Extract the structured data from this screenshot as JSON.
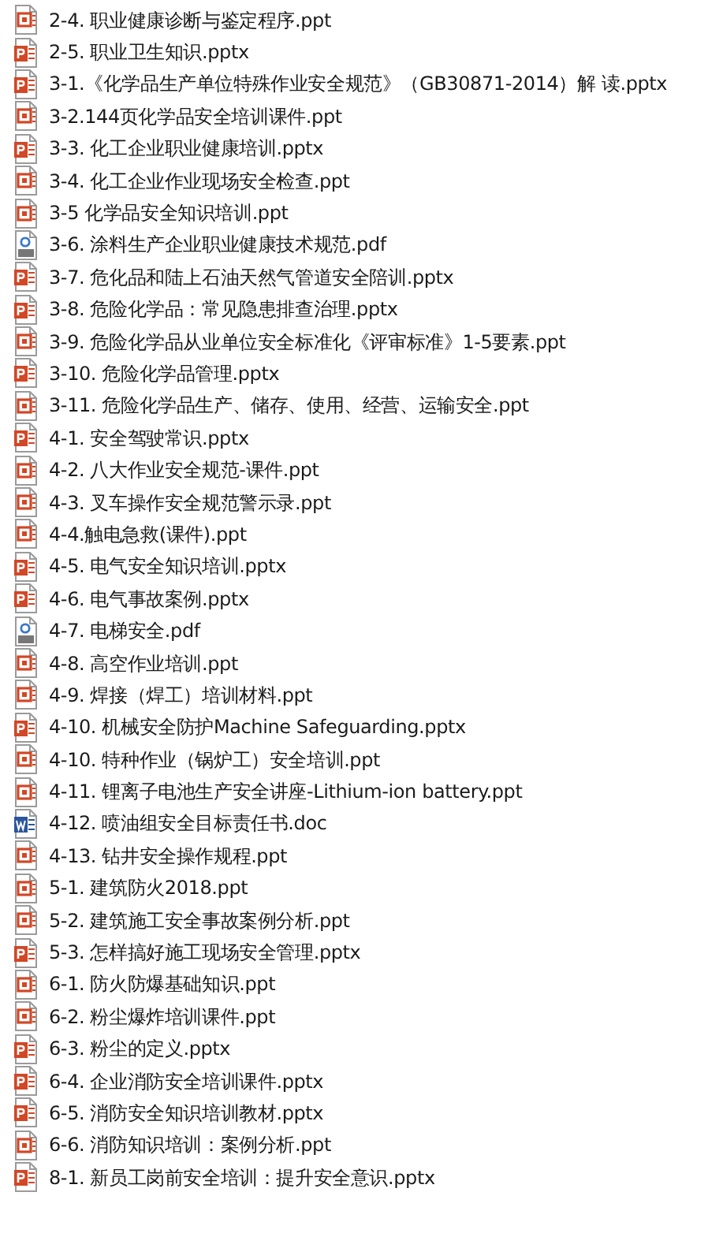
{
  "files": [
    {
      "name": "2-4. 职业健康诊断与鉴定程序.ppt",
      "kind": "ppt"
    },
    {
      "name": "2-5. 职业卫生知识.pptx",
      "kind": "pptx"
    },
    {
      "name": "3-1.《化学品生产单位特殊作业安全规范》（GB30871-2014）解 读.pptx",
      "kind": "pptx"
    },
    {
      "name": "3-2.144页化学品安全培训课件.ppt",
      "kind": "ppt"
    },
    {
      "name": "3-3. 化工企业职业健康培训.pptx",
      "kind": "pptx"
    },
    {
      "name": "3-4. 化工企业作业现场安全检查.ppt",
      "kind": "ppt"
    },
    {
      "name": "3-5 化学品安全知识培训.ppt",
      "kind": "ppt"
    },
    {
      "name": "3-6. 涂料生产企业职业健康技术规范.pdf",
      "kind": "pdf"
    },
    {
      "name": "3-7. 危化品和陆上石油天然气管道安全陪训.pptx",
      "kind": "pptx"
    },
    {
      "name": "3-8. 危险化学品：常见隐患排查治理.pptx",
      "kind": "pptx"
    },
    {
      "name": "3-9. 危险化学品从业单位安全标准化《评审标准》1-5要素.ppt",
      "kind": "ppt"
    },
    {
      "name": "3-10. 危险化学品管理.pptx",
      "kind": "pptx"
    },
    {
      "name": "3-11. 危险化学品生产、储存、使用、经营、运输安全.ppt",
      "kind": "ppt"
    },
    {
      "name": "4-1. 安全驾驶常识.pptx",
      "kind": "pptx"
    },
    {
      "name": "4-2. 八大作业安全规范-课件.ppt",
      "kind": "ppt"
    },
    {
      "name": "4-3. 叉车操作安全规范警示录.ppt",
      "kind": "ppt"
    },
    {
      "name": "4-4.触电急救(课件).ppt",
      "kind": "ppt"
    },
    {
      "name": "4-5. 电气安全知识培训.pptx",
      "kind": "pptx"
    },
    {
      "name": "4-6. 电气事故案例.pptx",
      "kind": "pptx"
    },
    {
      "name": "4-7. 电梯安全.pdf",
      "kind": "pdf"
    },
    {
      "name": "4-8. 高空作业培训.ppt",
      "kind": "ppt"
    },
    {
      "name": "4-9. 焊接（焊工）培训材料.ppt",
      "kind": "ppt"
    },
    {
      "name": "4-10. 机械安全防护Machine Safeguarding.pptx",
      "kind": "pptx"
    },
    {
      "name": "4-10. 特种作业（锅炉工）安全培训.ppt",
      "kind": "ppt"
    },
    {
      "name": "4-11. 锂离子电池生产安全讲座-Lithium-ion battery.ppt",
      "kind": "ppt"
    },
    {
      "name": "4-12. 喷油组安全目标责任书.doc",
      "kind": "doc"
    },
    {
      "name": "4-13. 钻井安全操作规程.ppt",
      "kind": "ppt"
    },
    {
      "name": "5-1. 建筑防火2018.ppt",
      "kind": "ppt"
    },
    {
      "name": "5-2. 建筑施工安全事故案例分析.ppt",
      "kind": "ppt"
    },
    {
      "name": "5-3. 怎样搞好施工现场安全管理.pptx",
      "kind": "pptx"
    },
    {
      "name": "6-1. 防火防爆基础知识.ppt",
      "kind": "ppt"
    },
    {
      "name": "6-2. 粉尘爆炸培训课件.ppt",
      "kind": "ppt"
    },
    {
      "name": "6-3. 粉尘的定义.pptx",
      "kind": "pptx"
    },
    {
      "name": "6-4. 企业消防安全培训课件.pptx",
      "kind": "pptx"
    },
    {
      "name": "6-5. 消防安全知识培训教材.pptx",
      "kind": "pptx"
    },
    {
      "name": "6-6. 消防知识培训：案例分析.ppt",
      "kind": "ppt"
    },
    {
      "name": "8-1. 新员工岗前安全培训：提升安全意识.pptx",
      "kind": "pptx"
    }
  ]
}
